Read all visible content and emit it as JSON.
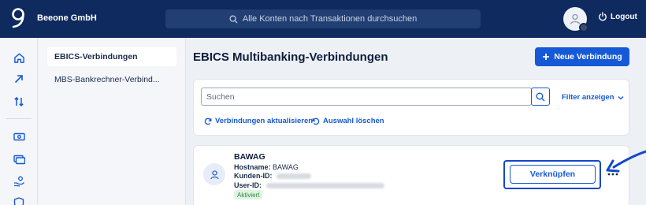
{
  "header": {
    "company": "Beeone GmbH",
    "search_placeholder": "Alle Konten nach Transaktionen durchsuchen",
    "logout_label": "Logout"
  },
  "rail": {
    "icons": [
      "home-icon",
      "arrow-up-right-icon",
      "transfer-icon",
      "cash-icon",
      "cards-icon",
      "hand-coin-icon",
      "shield-icon"
    ]
  },
  "subnav": {
    "items": [
      {
        "label": "EBICS-Verbindungen",
        "active": true
      },
      {
        "label": "MBS-Bankrechner-Verbind...",
        "active": false
      }
    ]
  },
  "main": {
    "title": "EBICS Multibanking-Verbindungen",
    "new_button": "Neue Verbindung",
    "filter": {
      "search_placeholder": "Suchen",
      "toggle_label": "Filter anzeigen",
      "refresh_label": "Verbindungen aktualisieren",
      "clear_label": "Auswahl löschen"
    },
    "connection": {
      "name": "BAWAG",
      "hostname_label": "Hostname:",
      "hostname_value": "BAWAG",
      "customer_id_label": "Kunden-ID:",
      "user_id_label": "User-ID:",
      "status": "Aktiviert",
      "connect_button": "Verknüpfen"
    }
  },
  "colors": {
    "header_bg": "#0e2a5e",
    "accent": "#1659d6",
    "annotation": "#1348c7",
    "status_green": "#2f8a3e"
  }
}
